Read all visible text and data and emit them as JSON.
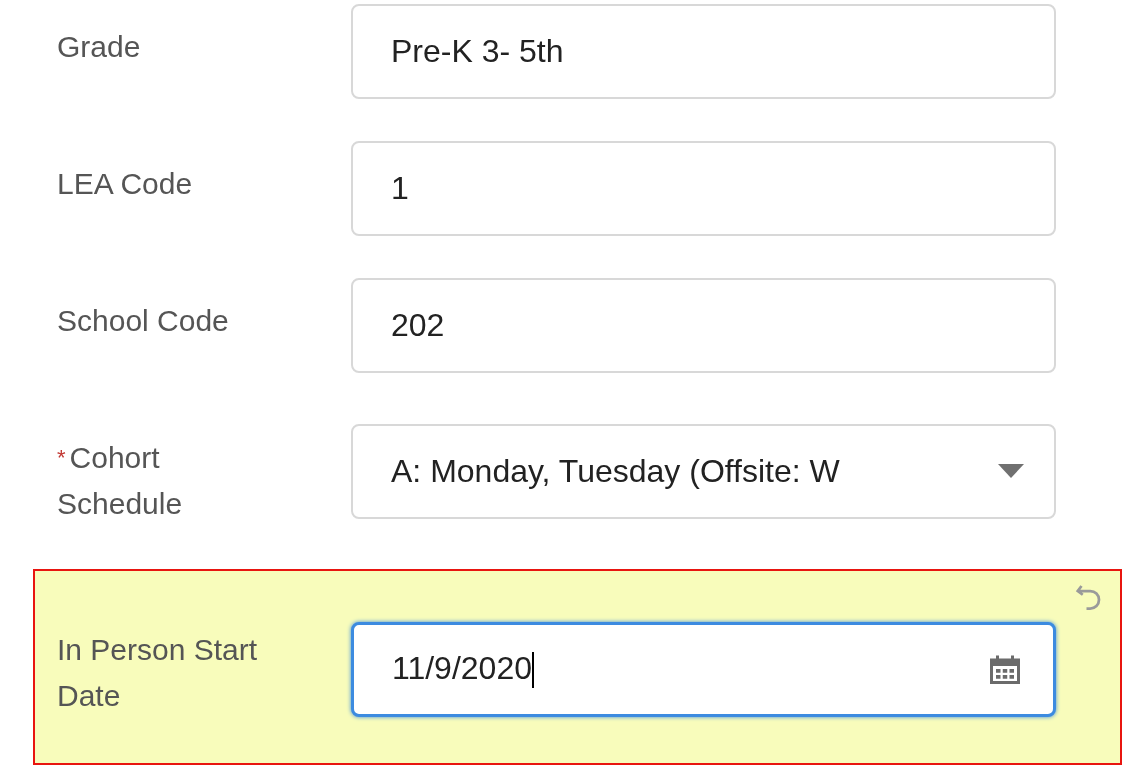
{
  "fields": [
    {
      "kind": "text",
      "label": "Grade",
      "value": "Pre-K 3- 5th",
      "changed": false,
      "focused": false
    },
    {
      "kind": "text",
      "label": "LEA Code",
      "value": "1",
      "changed": false,
      "focused": false
    },
    {
      "kind": "text",
      "label": "School Code",
      "value": "202",
      "changed": false,
      "focused": false
    },
    {
      "kind": "select",
      "required_mark": "*",
      "label": "Cohort Schedule",
      "value": "A: Monday, Tuesday (Offsite: W",
      "changed": false,
      "focused": false
    },
    {
      "kind": "date",
      "label": "In Person Start Date",
      "value": "11/9/2020",
      "changed": true,
      "focused": true
    }
  ]
}
